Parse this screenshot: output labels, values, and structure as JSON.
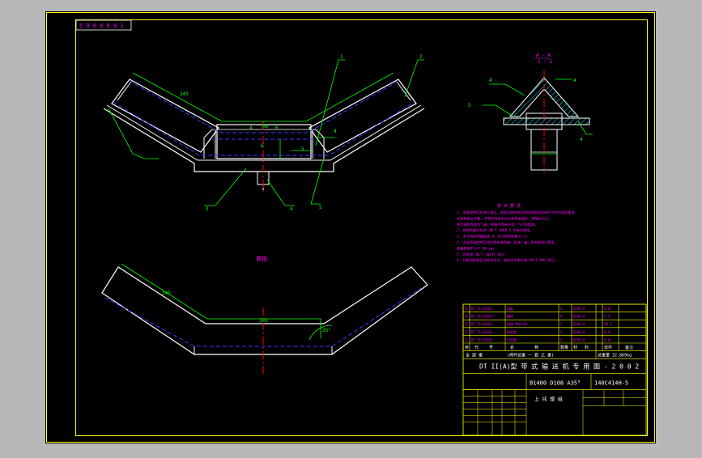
{
  "colors": {
    "background": "#000000",
    "frame": "#ffff00",
    "outline": "#ffffff",
    "hidden": "#3a3aff",
    "dimension": "#00ff00",
    "centerline": "#ff0000",
    "text": "#ff00ff",
    "hatch": "#00e5ff"
  },
  "drawing": {
    "code_box": "5 9 0 0 0 0 1",
    "top_view": {
      "callouts": [
        "1",
        "2",
        "3",
        "4",
        "5"
      ],
      "dims": [
        "R6",
        "4",
        "6",
        "5",
        "4",
        "345",
        "6"
      ]
    },
    "bottom_view": {
      "title": "俯视",
      "dims": [
        "345",
        "345",
        "35°"
      ]
    },
    "section": {
      "title": "A - A",
      "scale": "1 : 2",
      "labels": [
        "4",
        "5",
        "4",
        "4"
      ]
    },
    "notes": {
      "title": "技 术 要 求",
      "lines": [
        "1. 支架焊接后应进行校正，保证托辊安装孔的同轴度和安装尺寸符合图样要求。",
        "   支架表面应平整，不得有明显的凹凸和焊接变形，焊缝应均匀。",
        "   焊后清除焊渣及飞溅，焊缝不得有夹渣、气孔和裂纹。",
        "2. 焊接质量应符合 JB/T 5000.3 的有关规定。",
        "3. 未注明的焊缝高度 4，未注明的倒角为 C1。",
        "4. 支架表面除锈后涂防锈底漆两遍，面漆一遍，颜色按用户要求，",
        "   漆膜厚度不小于 80 μm。",
        "5. 其余按 JB/T 10297 执行。",
        "6. 托辊组安装后应转动灵活，其他技术要求按 GB/T 990 执行。"
      ]
    },
    "parts_table": {
      "rows": [
        {
          "no": "5",
          "code": "DT II(A)03J",
          "name": "挡板",
          "qty": "2",
          "material": "Q235-A",
          "wt": "0.8"
        },
        {
          "no": "4",
          "code": "DT II(A)03J",
          "name": "螺栓",
          "qty": "4",
          "material": "Q235-A",
          "wt": "1.2"
        },
        {
          "no": "3",
          "code": "DT II(A)03J",
          "name": "底座 M16×50",
          "qty": "1",
          "material": "Q235-A",
          "wt": "10.5"
        },
        {
          "no": "2",
          "code": "DT II(A)03J",
          "name": "侧支架",
          "qty": "2",
          "material": "Q235-A",
          "wt": "6.4"
        },
        {
          "no": "1",
          "code": "DT II(A)03J",
          "name": "中支架",
          "qty": "1",
          "material": "Q235-A",
          "wt": "5.6"
        }
      ],
      "headers": [
        "序",
        "代",
        "号",
        "名",
        "称",
        "数量",
        "材",
        "料",
        "单件",
        "备注"
      ],
      "summary": [
        "全 部 重",
        "(焊件总重 一 套 之 重)",
        "总重量 32.869kg"
      ],
      "series": "DT II(A)型 带 式 输 送 机 专 用 图 - 2 0 0 2",
      "spec": "B1400 D108 A35°",
      "drawing_no": "140C414H-5",
      "part_name": "上 托 辊 组"
    }
  }
}
